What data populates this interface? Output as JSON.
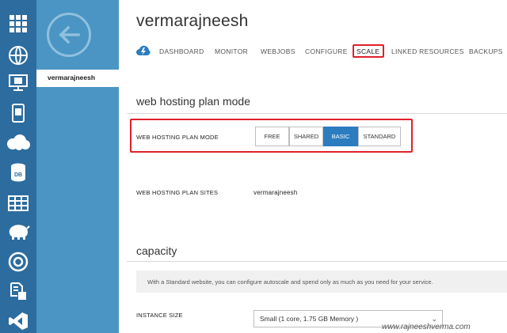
{
  "site": {
    "title": "vermarajneesh"
  },
  "sidebar": {
    "selected_item": "vermarajneesh"
  },
  "rail": {
    "items": [
      {
        "icon": "all-items-grid-icon"
      },
      {
        "icon": "web-sites-icon"
      },
      {
        "icon": "virtual-machines-icon"
      },
      {
        "icon": "mobile-services-icon"
      },
      {
        "icon": "cloud-services-icon"
      },
      {
        "icon": "sql-databases-icon"
      },
      {
        "icon": "storage-icon"
      },
      {
        "icon": "hdinsight-icon"
      },
      {
        "icon": "media-services-icon"
      },
      {
        "icon": "service-bus-icon"
      },
      {
        "icon": "visual-studio-icon"
      }
    ]
  },
  "nav": {
    "tabs": [
      {
        "label": "DASHBOARD"
      },
      {
        "label": "MONITOR"
      },
      {
        "label": "WEBJOBS"
      },
      {
        "label": "CONFIGURE"
      },
      {
        "label": "SCALE"
      },
      {
        "label": "LINKED RESOURCES"
      },
      {
        "label": "BACKUPS"
      }
    ],
    "active_tab": "SCALE"
  },
  "plan": {
    "section_title": "web hosting plan mode",
    "mode_label": "WEB HOSTING PLAN MODE",
    "options": [
      "FREE",
      "SHARED",
      "BASIC",
      "STANDARD"
    ],
    "selected": "BASIC",
    "sites_label": "WEB HOSTING PLAN SITES",
    "sites_value": "vermarajneesh"
  },
  "capacity": {
    "section_title": "capacity",
    "info_text": "With a Standard website, you can configure autoscale and spend only as much as you need for your service.",
    "instance_size_label": "INSTANCE SIZE",
    "instance_size_value": "Small (1 core, 1.75 GB Memory )"
  },
  "watermark": "www.rajneeshverma.com",
  "colors": {
    "rail": "#2d6c9e",
    "sidebar": "#4a95c3",
    "accent": "#2b7dc0",
    "highlight_border": "#e0202b"
  }
}
